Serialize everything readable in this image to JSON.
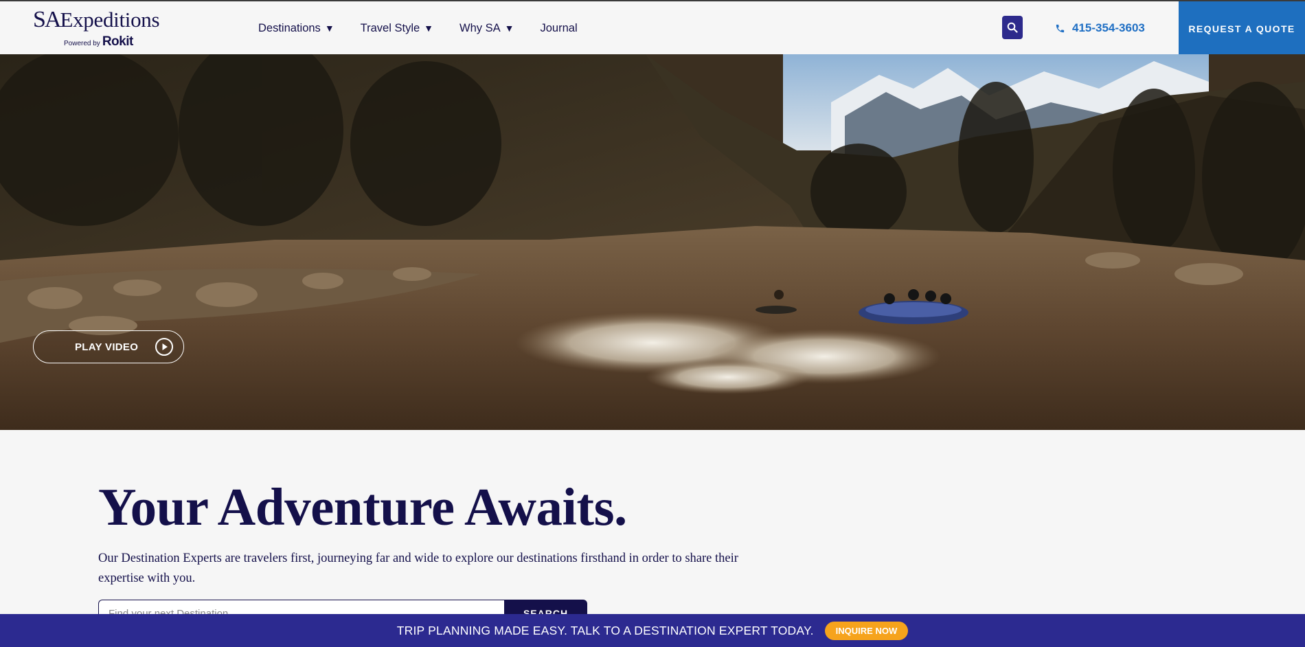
{
  "brand": {
    "logo_sa": "SA",
    "logo_name": "Expeditions",
    "powered_by": "Powered by",
    "partner": "Rokit"
  },
  "nav": {
    "items": [
      {
        "label": "Destinations",
        "caret": "▼"
      },
      {
        "label": "Travel Style",
        "caret": "▼"
      },
      {
        "label": "Why SA",
        "caret": "▼"
      },
      {
        "label": "Journal",
        "caret": ""
      }
    ]
  },
  "header": {
    "search_icon": "search-icon",
    "phone_icon": "phone-icon",
    "phone": "415-354-3603",
    "quote_label": "REQUEST A QUOTE"
  },
  "hero": {
    "play_label": "PLAY VIDEO",
    "play_icon": "play-circle-icon"
  },
  "main": {
    "headline": "Your Adventure Awaits.",
    "intro": "Our Destination Experts are travelers first, journeying far and wide to explore our destinations firsthand in order to share their expertise with you.",
    "search_placeholder": "Find your next Destination",
    "search_button": "SEARCH"
  },
  "bottom_bar": {
    "text": "TRIP PLANNING MADE EASY. TALK TO A DESTINATION EXPERT TODAY.",
    "cta": "INQUIRE NOW"
  },
  "colors": {
    "navy": "#14104a",
    "brand_blue": "#1e6fbf",
    "bar_purple": "#2c2a90",
    "accent_orange": "#f6a31c",
    "search_button_bg": "#2d2a8c"
  }
}
